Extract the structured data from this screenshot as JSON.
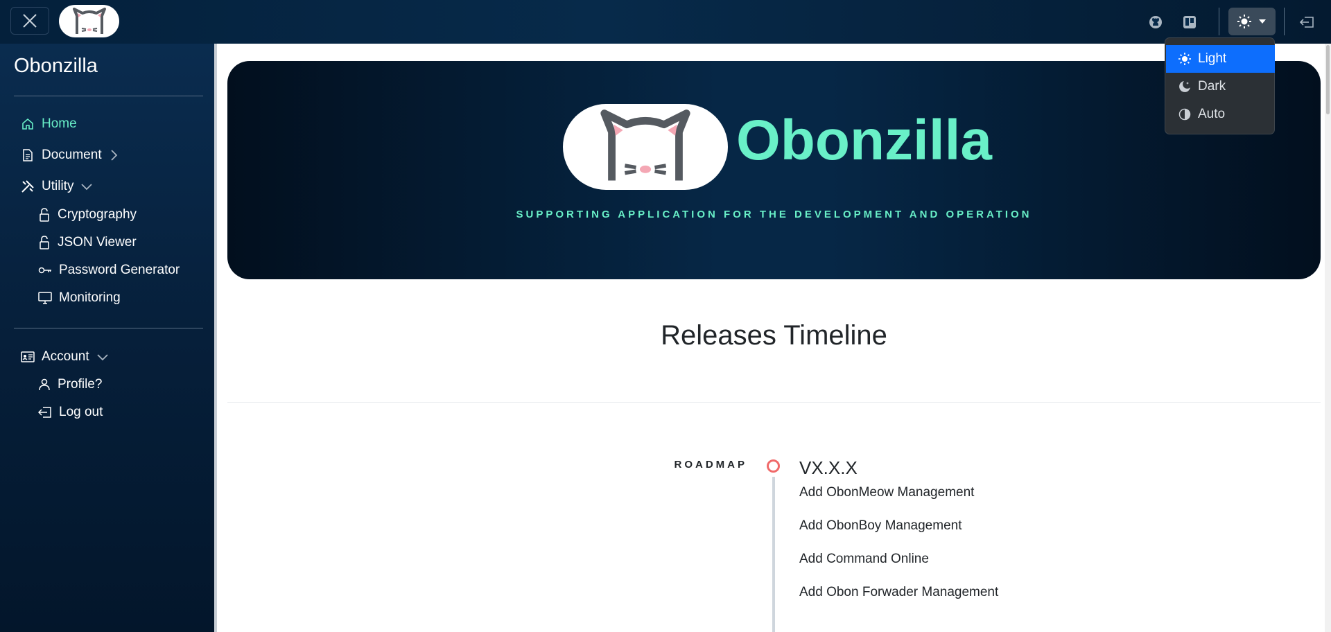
{
  "topbar": {
    "icons": [
      "close-icon",
      "cat-logo-icon",
      "github-icon",
      "trello-icon",
      "sun-icon",
      "caret-down-icon",
      "logout-icon"
    ]
  },
  "sidebar": {
    "brand": "Obonzilla",
    "items": [
      {
        "label": "Home",
        "icon": "house-icon",
        "active": true
      },
      {
        "label": "Document",
        "icon": "file-icon"
      },
      {
        "label": "Utility",
        "icon": "tools-icon"
      },
      {
        "label": "Cryptography",
        "icon": "lock-icon"
      },
      {
        "label": "JSON Viewer",
        "icon": "lock-icon"
      },
      {
        "label": "Password Generator",
        "icon": "key-icon"
      },
      {
        "label": "Monitoring",
        "icon": "monitor-icon"
      },
      {
        "label": "Account",
        "icon": "id-card-icon"
      },
      {
        "label": "Profile?",
        "icon": "person-icon"
      },
      {
        "label": "Log out",
        "icon": "logout-icon"
      }
    ]
  },
  "hero": {
    "title": "Obonzilla",
    "subtitle": "SUPPORTING APPLICATION FOR THE DEVELOPMENT AND OPERATION"
  },
  "timeline": {
    "heading": "Releases Timeline",
    "label": "ROADMAP",
    "version": "VX.X.X",
    "entries": [
      "Add ObonMeow Management",
      "Add ObonBoy Management",
      "Add Command Online",
      "Add Obon Forwader Management"
    ]
  },
  "theme_menu": {
    "options": [
      {
        "label": "Light",
        "icon": "sun-icon",
        "selected": true
      },
      {
        "label": "Dark",
        "icon": "moon-stars-icon"
      },
      {
        "label": "Auto",
        "icon": "circle-half-icon"
      }
    ],
    "accent": "#0d6efd"
  },
  "colors": {
    "brand_accent": "#69f0c8",
    "navy": "#062746",
    "timeline_dot": "#f06a6a"
  }
}
